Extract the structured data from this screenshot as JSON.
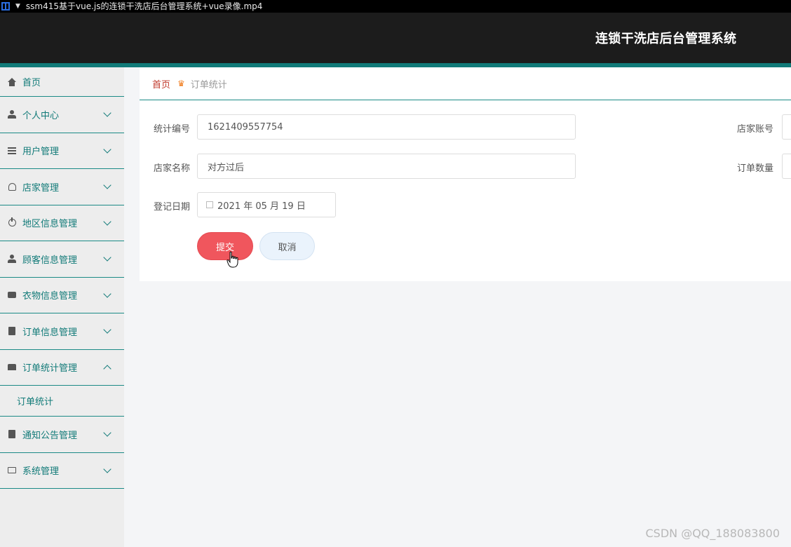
{
  "window": {
    "title": "ssm415基于vue.js的连锁干洗店后台管理系统+vue录像.mp4"
  },
  "header": {
    "app_title": "连锁干洗店后台管理系统"
  },
  "sidebar": {
    "items": [
      {
        "label": "首页",
        "icon": "home-icon"
      },
      {
        "label": "个人中心",
        "icon": "user-icon"
      },
      {
        "label": "用户管理",
        "icon": "list-icon"
      },
      {
        "label": "店家管理",
        "icon": "bell-icon"
      },
      {
        "label": "地区信息管理",
        "icon": "power-icon"
      },
      {
        "label": "顾客信息管理",
        "icon": "user-icon"
      },
      {
        "label": "衣物信息管理",
        "icon": "chat-icon"
      },
      {
        "label": "订单信息管理",
        "icon": "doc-icon"
      },
      {
        "label": "订单统计管理",
        "icon": "printer-icon",
        "expanded": true,
        "children": [
          {
            "label": "订单统计"
          }
        ]
      },
      {
        "label": "通知公告管理",
        "icon": "clipboard-icon"
      },
      {
        "label": "系统管理",
        "icon": "card-icon"
      }
    ]
  },
  "breadcrumb": {
    "home": "首页",
    "current": "订单统计"
  },
  "form": {
    "stat_no": {
      "label": "统计编号",
      "value": "1621409557754"
    },
    "shop_account": {
      "label": "店家账号",
      "value": ""
    },
    "shop_name": {
      "label": "店家名称",
      "value": "对方过后"
    },
    "order_count": {
      "label": "订单数量",
      "value": ""
    },
    "reg_date": {
      "label": "登记日期",
      "value": "2021 年 05 月 19 日"
    },
    "submit_label": "提交",
    "cancel_label": "取消"
  },
  "watermark": "CSDN @QQ_188083800",
  "colors": {
    "accent": "#117a78",
    "submit": "#f0565d",
    "header_bg": "#1c1c1c"
  }
}
